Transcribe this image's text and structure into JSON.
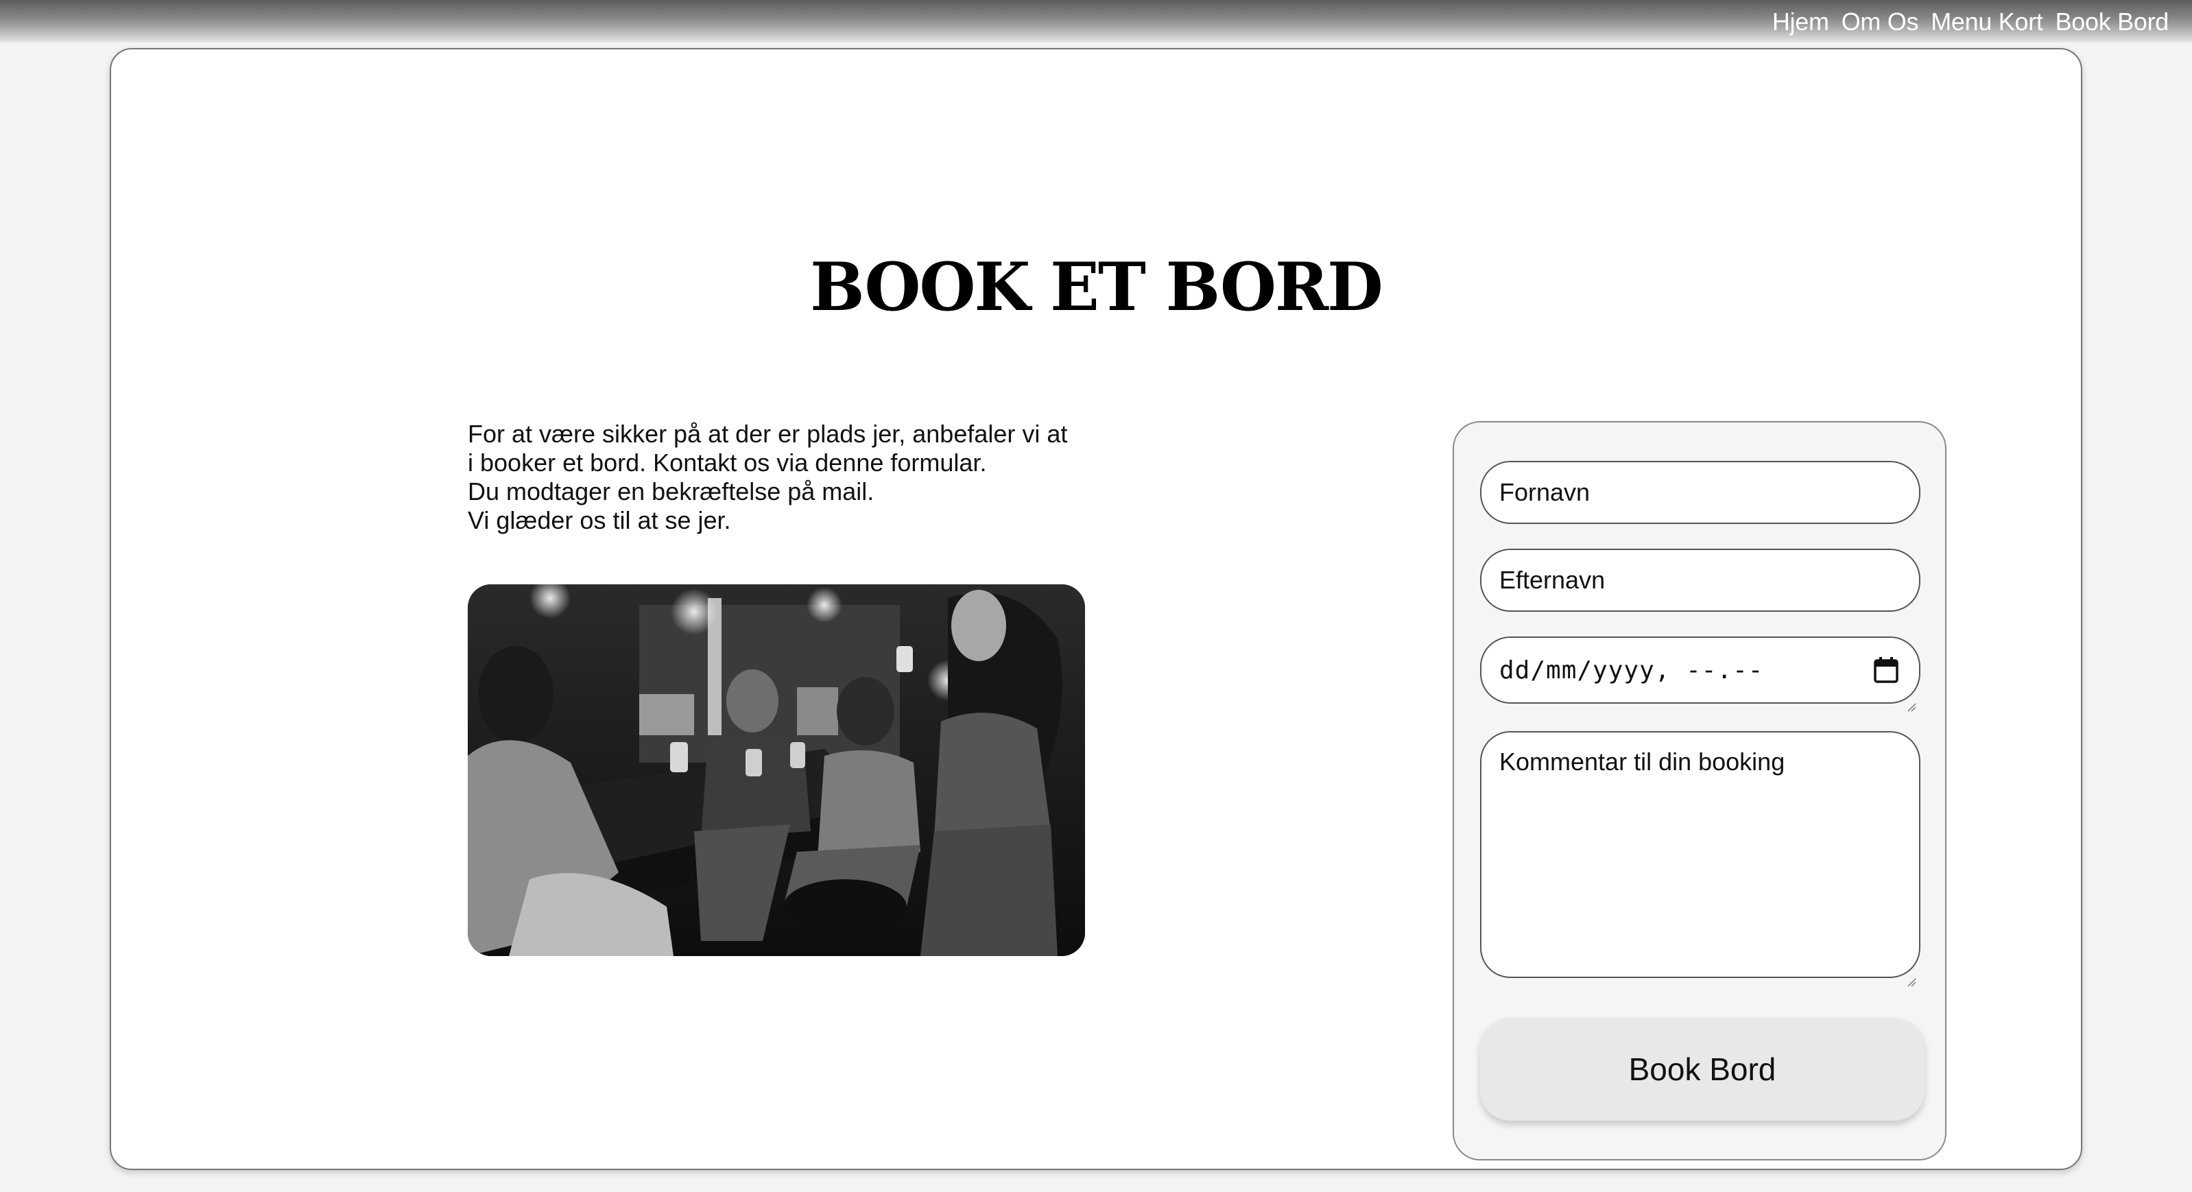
{
  "nav": {
    "items": [
      {
        "label": "Hjem"
      },
      {
        "label": "Om Os"
      },
      {
        "label": "Menu Kort"
      },
      {
        "label": "Book Bord"
      }
    ]
  },
  "page": {
    "title": "BOOK ET BORD",
    "intro_lines": [
      "For at være sikker på at der er plads jer, anbefaler vi at",
      "i booker et bord. Kontakt os via denne formular.",
      "Du modtager en bekræftelse på mail.",
      "Vi glæder os til at se jer."
    ]
  },
  "form": {
    "first_name_placeholder": "Fornavn",
    "last_name_placeholder": "Efternavn",
    "datetime_placeholder": "dd/mm/yyyy, --.--",
    "comment_placeholder": "Kommentar til din booking",
    "submit_label": "Book Bord"
  },
  "colors": {
    "card_background": "#ffffff",
    "page_background": "#f4f4f4",
    "form_panel_background": "#f5f5f5",
    "button_background": "#e8e8e8",
    "nav_text": "#ffffff"
  },
  "icons": {
    "datetime": "calendar-icon"
  }
}
